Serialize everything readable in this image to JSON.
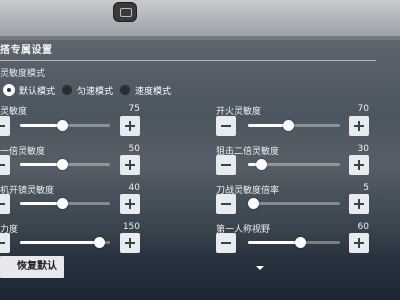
{
  "page": {
    "title": "搭专属设置",
    "mode_label": "灵敏度模式",
    "reset_label": "恢复默认"
  },
  "modes": [
    {
      "label": "默认模式",
      "selected": true
    },
    {
      "label": "匀速模式",
      "selected": false
    },
    {
      "label": "速度模式",
      "selected": false
    }
  ],
  "left_rows": [
    {
      "label": "灵敏度",
      "value": "75",
      "level": 0.47
    },
    {
      "label": "一倍灵敏度",
      "value": "50",
      "level": 0.47
    },
    {
      "label": "机开镜灵敏度",
      "value": "40",
      "level": 0.47
    },
    {
      "label": "力度",
      "value": "150",
      "level": 0.88
    }
  ],
  "right_rows": [
    {
      "label": "开火灵敏度",
      "value": "70",
      "level": 0.44
    },
    {
      "label": "狙击二倍灵敏度",
      "value": "30",
      "level": 0.14
    },
    {
      "label": "刀战灵敏度倍率",
      "value": "5",
      "level": 0.05
    },
    {
      "label": "第一人称视野",
      "value": "60",
      "level": 0.56
    }
  ],
  "colors": {
    "accent": "#ffffff",
    "button_bg": "#e9ecee"
  },
  "icons": {
    "minus": "minus-icon",
    "plus": "plus-icon"
  }
}
